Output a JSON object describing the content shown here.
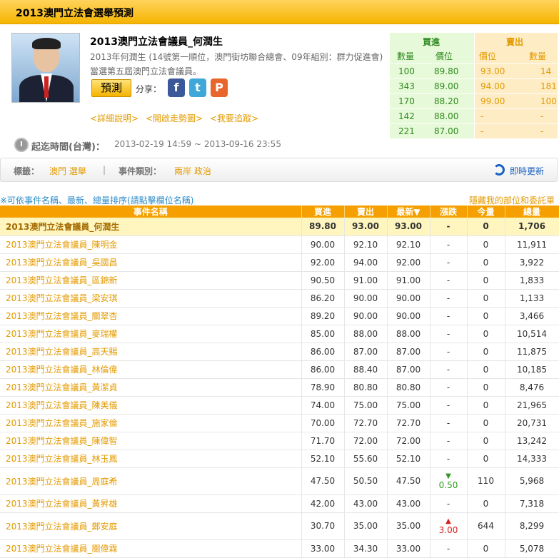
{
  "header": {
    "title": "2013澳門立法會選舉預測"
  },
  "event": {
    "name": "2013澳門立法會議員_何潤生",
    "description": "2013年何潤生 (14號第一順位，澳門街坊聯合總會、09年組別：群力促進會)當選第五屆澳門立法會議員。",
    "predict_label": "預測",
    "share_label": "分享：",
    "share_icons": [
      "facebook-icon",
      "twitter-icon",
      "plurk-icon"
    ],
    "links": [
      "<詳細說明>",
      "<開啟走勢圖>",
      "<我要追蹤>"
    ],
    "time_label": "起迄時間(台灣)：",
    "time_value": "2013-02-19 14:59 ~ 2013-09-16 23:55"
  },
  "orderbook": {
    "buy_header": "買進",
    "sell_header": "賣出",
    "buy_cols": [
      "數量",
      "價位"
    ],
    "sell_cols": [
      "價位",
      "數量"
    ],
    "buy": [
      [
        "100",
        "89.80"
      ],
      [
        "343",
        "89.00"
      ],
      [
        "170",
        "88.20"
      ],
      [
        "142",
        "88.00"
      ],
      [
        "221",
        "87.00"
      ]
    ],
    "sell": [
      [
        "93.00",
        "14"
      ],
      [
        "94.00",
        "181"
      ],
      [
        "99.00",
        "100"
      ],
      [
        "-",
        "-"
      ],
      [
        "-",
        "-"
      ]
    ]
  },
  "tags": {
    "tag_label": "標籤：",
    "tag_value": "澳門 選舉",
    "separator": "|",
    "category_label": "事件類別：",
    "category_value": "兩岸 政治",
    "refresh_label": "即時更新"
  },
  "list": {
    "sort_hint": "※可依事件名稱、最新、總量排序(請點擊欄位名稱)",
    "hide_link": "隱藏我的部位和委託單",
    "columns": [
      "事件名稱",
      "買進",
      "賣出",
      "最新▼",
      "漲跌",
      "今量",
      "總量"
    ],
    "rows": [
      {
        "name": "2013澳門立法會議員_何潤生",
        "buy": "89.80",
        "sell": "93.00",
        "last": "93.00",
        "chg": "-",
        "today": "0",
        "total": "1,706"
      },
      {
        "name": "2013澳門立法會議員_陳明金",
        "buy": "90.00",
        "sell": "92.10",
        "last": "92.10",
        "chg": "-",
        "today": "0",
        "total": "11,911"
      },
      {
        "name": "2013澳門立法會議員_吳國昌",
        "buy": "92.00",
        "sell": "94.00",
        "last": "92.00",
        "chg": "-",
        "today": "0",
        "total": "3,922"
      },
      {
        "name": "2013澳門立法會議員_區錦新",
        "buy": "90.50",
        "sell": "91.00",
        "last": "91.00",
        "chg": "-",
        "today": "0",
        "total": "1,833"
      },
      {
        "name": "2013澳門立法會議員_梁安琪",
        "buy": "86.20",
        "sell": "90.00",
        "last": "90.00",
        "chg": "-",
        "today": "0",
        "total": "1,133"
      },
      {
        "name": "2013澳門立法會議員_關翠杏",
        "buy": "89.20",
        "sell": "90.00",
        "last": "90.00",
        "chg": "-",
        "today": "0",
        "total": "3,466"
      },
      {
        "name": "2013澳門立法會議員_麥瑞權",
        "buy": "85.00",
        "sell": "88.00",
        "last": "88.00",
        "chg": "-",
        "today": "0",
        "total": "10,514"
      },
      {
        "name": "2013澳門立法會議員_高天賜",
        "buy": "86.00",
        "sell": "87.00",
        "last": "87.00",
        "chg": "-",
        "today": "0",
        "total": "11,875"
      },
      {
        "name": "2013澳門立法會議員_林倫偉",
        "buy": "86.00",
        "sell": "88.40",
        "last": "87.00",
        "chg": "-",
        "today": "0",
        "total": "10,185"
      },
      {
        "name": "2013澳門立法會議員_黃潔貞",
        "buy": "78.90",
        "sell": "80.80",
        "last": "80.80",
        "chg": "-",
        "today": "0",
        "total": "8,476"
      },
      {
        "name": "2013澳門立法會議員_陳美儀",
        "buy": "74.00",
        "sell": "75.00",
        "last": "75.00",
        "chg": "-",
        "today": "0",
        "total": "21,965"
      },
      {
        "name": "2013澳門立法會議員_施家倫",
        "buy": "70.00",
        "sell": "72.70",
        "last": "72.70",
        "chg": "-",
        "today": "0",
        "total": "20,731"
      },
      {
        "name": "2013澳門立法會議員_陳偉智",
        "buy": "71.70",
        "sell": "72.00",
        "last": "72.00",
        "chg": "-",
        "today": "0",
        "total": "13,242"
      },
      {
        "name": "2013澳門立法會議員_林玉鳳",
        "buy": "52.10",
        "sell": "55.60",
        "last": "52.10",
        "chg": "-",
        "today": "0",
        "total": "14,333"
      },
      {
        "name": "2013澳門立法會議員_周庭希",
        "buy": "47.50",
        "sell": "50.50",
        "last": "47.50",
        "chg": "0.50",
        "chg_dir": "down",
        "today": "110",
        "total": "5,968"
      },
      {
        "name": "2013澳門立法會議員_黃昇雄",
        "buy": "42.00",
        "sell": "43.00",
        "last": "43.00",
        "chg": "-",
        "today": "0",
        "total": "7,318"
      },
      {
        "name": "2013澳門立法會議員_鄭安庭",
        "buy": "30.70",
        "sell": "35.00",
        "last": "35.00",
        "chg": "3.00",
        "chg_dir": "up",
        "today": "644",
        "total": "8,299"
      },
      {
        "name": "2013澳門立法會議員_關偉霖",
        "buy": "33.00",
        "sell": "34.30",
        "last": "33.00",
        "chg": "-",
        "today": "0",
        "total": "5,078"
      }
    ]
  }
}
